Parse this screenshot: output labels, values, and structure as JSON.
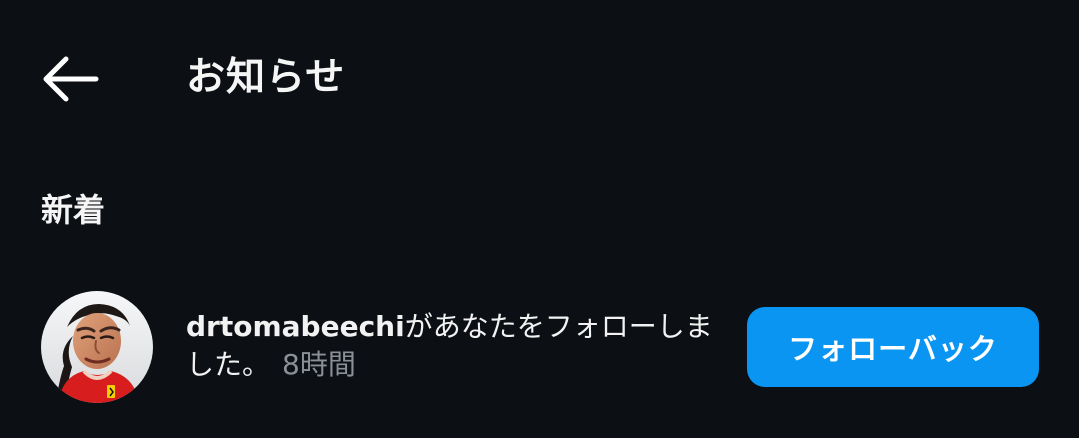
{
  "header": {
    "back_icon": "back-arrow-icon",
    "title": "お知らせ"
  },
  "sections": {
    "new_label": "新着"
  },
  "notification": {
    "username": "drtomabeechi",
    "message_part1": "があなたをフォローしま",
    "message_part2": "した。",
    "time": "8時間",
    "button_label": "フォローバック",
    "avatar_icon": "profile-avatar"
  },
  "colors": {
    "background": "#0c0f14",
    "text": "#f5f5f5",
    "secondary_text": "#8b8f96",
    "accent": "#0a95f2"
  }
}
